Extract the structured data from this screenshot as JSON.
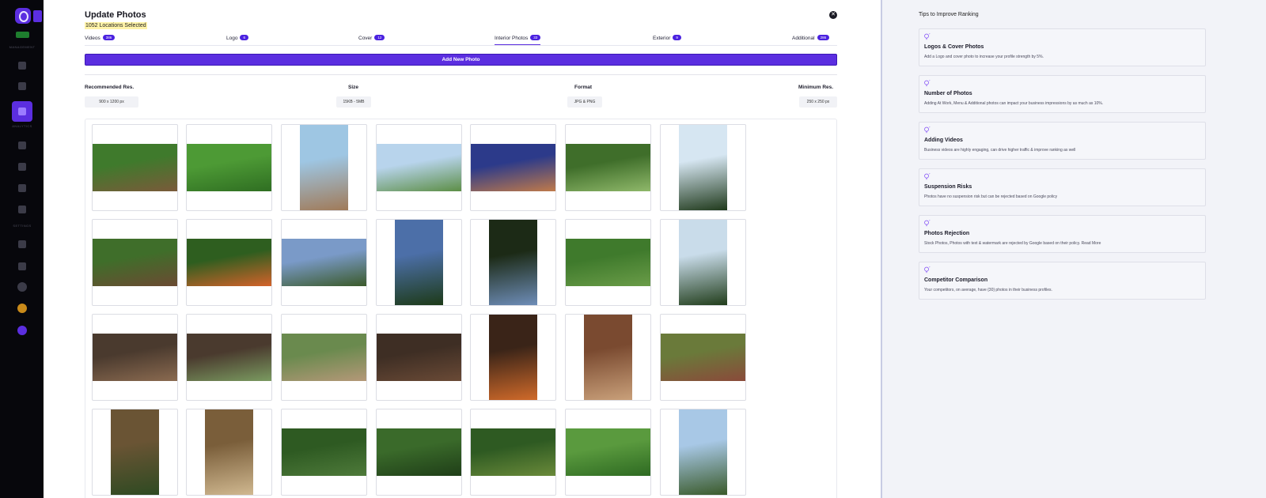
{
  "sidebar": {
    "sections": [
      "MANAGEMENT",
      "ANALYTICS",
      "SETTINGS"
    ]
  },
  "header": {
    "title": "Update Photos",
    "subtitle": "1052 Locations Selected"
  },
  "tabs": [
    {
      "label": "Videos",
      "count": "386"
    },
    {
      "label": "Logo",
      "count": "6"
    },
    {
      "label": "Cover",
      "count": "12"
    },
    {
      "label": "Interior Photos",
      "count": "33"
    },
    {
      "label": "Exterior",
      "count": "9"
    },
    {
      "label": "Additional",
      "count": "286"
    }
  ],
  "add_button": "Add New Photo",
  "specs": {
    "recommended": {
      "label": "Recommended Res.",
      "value": "900 x 1200 px"
    },
    "size": {
      "label": "Size",
      "value": "15KB - 5MB"
    },
    "format": {
      "label": "Format",
      "value": "JPG & PNG"
    },
    "minimum": {
      "label": "Minimum Res.",
      "value": "250 x 250 px"
    }
  },
  "colors": {
    "accent": "#5b2ee0",
    "highlight": "#fff3a8"
  },
  "photos": [
    {
      "orient": "landscape",
      "colors": [
        "#3f7a2c",
        "#7a5a3a"
      ]
    },
    {
      "orient": "landscape",
      "colors": [
        "#4d9a35",
        "#2f6e22"
      ]
    },
    {
      "orient": "portrait",
      "colors": [
        "#9ec6e3",
        "#a07a58"
      ]
    },
    {
      "orient": "landscape",
      "colors": [
        "#b8d4ec",
        "#5c8e46"
      ]
    },
    {
      "orient": "landscape",
      "colors": [
        "#2c3a8a",
        "#c07a4a"
      ]
    },
    {
      "orient": "landscape",
      "colors": [
        "#3f6e2a",
        "#8fb86a"
      ]
    },
    {
      "orient": "portrait",
      "colors": [
        "#d6e6f2",
        "#203a1c"
      ]
    },
    {
      "orient": "landscape",
      "colors": [
        "#3f6e2a",
        "#6b4a32"
      ]
    },
    {
      "orient": "landscape",
      "colors": [
        "#2e5e1f",
        "#d4622a"
      ]
    },
    {
      "orient": "landscape",
      "colors": [
        "#7a9ac8",
        "#3b5a2a"
      ]
    },
    {
      "orient": "portrait",
      "colors": [
        "#4c6fa8",
        "#1d3a18"
      ]
    },
    {
      "orient": "portrait",
      "colors": [
        "#1c2a16",
        "#6e8db8"
      ]
    },
    {
      "orient": "landscape",
      "colors": [
        "#3f7a2c",
        "#6a9c48"
      ]
    },
    {
      "orient": "portrait",
      "colors": [
        "#c9dcea",
        "#213d1b"
      ]
    },
    {
      "orient": "landscape",
      "colors": [
        "#4a3a2e",
        "#8a6a50"
      ]
    },
    {
      "orient": "landscape",
      "colors": [
        "#4a3a2e",
        "#7a9a60"
      ]
    },
    {
      "orient": "landscape",
      "colors": [
        "#6a8a4e",
        "#b49878"
      ]
    },
    {
      "orient": "landscape",
      "colors": [
        "#3e2e24",
        "#6a4a36"
      ]
    },
    {
      "orient": "portrait",
      "colors": [
        "#3a2418",
        "#d06a2a"
      ]
    },
    {
      "orient": "portrait",
      "colors": [
        "#7a4a30",
        "#c9a07a"
      ]
    },
    {
      "orient": "landscape",
      "colors": [
        "#6a7a3a",
        "#8a4a3a"
      ]
    },
    {
      "orient": "portrait",
      "colors": [
        "#6a5434",
        "#2e4a22"
      ]
    },
    {
      "orient": "portrait",
      "colors": [
        "#7a5e3a",
        "#d0b890"
      ]
    },
    {
      "orient": "landscape",
      "colors": [
        "#2e5a22",
        "#4e7a3a"
      ]
    },
    {
      "orient": "landscape",
      "colors": [
        "#3a6a2a",
        "#1f3e18"
      ]
    },
    {
      "orient": "landscape",
      "colors": [
        "#2e5a22",
        "#6a8a3a"
      ]
    },
    {
      "orient": "landscape",
      "colors": [
        "#5a9a3e",
        "#2e6a22"
      ]
    },
    {
      "orient": "portrait",
      "colors": [
        "#a8c8e6",
        "#3a5a2a"
      ]
    }
  ],
  "tips": {
    "heading": "Tips to Improve Ranking",
    "items": [
      {
        "title": "Logos & Cover Photos",
        "desc": "Add a Logo and cover photo to increase your profile strength by 5%."
      },
      {
        "title": "Number of Photos",
        "desc": "Adding At Work, Menu & Additional photos can impact your business impressions by as much as 10%."
      },
      {
        "title": "Adding Videos",
        "desc": "Business videos are highly engaging, can drive higher traffic & improve ranking as well"
      },
      {
        "title": "Suspension Risks",
        "desc": "Photos have no suspension risk but can be rejected based on Google policy"
      },
      {
        "title": "Photos Rejection",
        "desc": "Stock Photos, Photos with text & watermark are rejected by Google based on their policy. Read More"
      },
      {
        "title": "Competitor Comparison",
        "desc": "Your competitors, on average, have {30} photos in their business profiles."
      }
    ]
  }
}
